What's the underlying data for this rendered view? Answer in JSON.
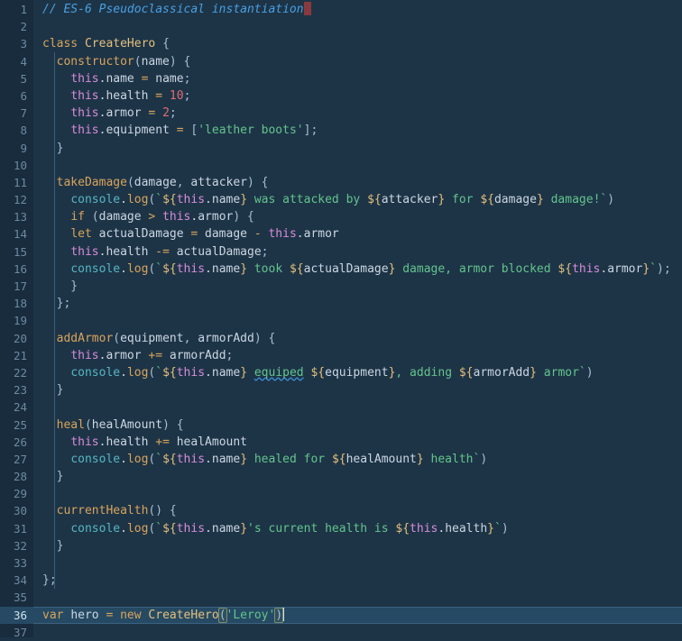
{
  "editor": {
    "name": "code-editor",
    "language": "javascript",
    "total_lines": 37,
    "active_line": 36,
    "colors": {
      "background": "#1d3447",
      "gutter_background": "#182c3e",
      "active_line_background": "#264a63",
      "line_number": "#6e8a9e",
      "default_text": "#cbd6e2",
      "comment": "#4a9fe0",
      "keyword": "#d9a45b",
      "string": "#64c48c",
      "number": "#e06c75",
      "this_keyword": "#d88cd8",
      "console_object": "#56b6c2",
      "template_delim": "#e5c07b",
      "punctuation": "#a8bdd0",
      "spellcheck_underline": "#3d8fd6",
      "cursor_primary": "#8a3a3f",
      "indent_guide": "#3b5e77"
    }
  },
  "gutter": {
    "line_numbers": [
      1,
      2,
      3,
      4,
      5,
      6,
      7,
      8,
      9,
      10,
      11,
      12,
      13,
      14,
      15,
      16,
      17,
      18,
      19,
      20,
      21,
      22,
      23,
      24,
      25,
      26,
      27,
      28,
      29,
      30,
      31,
      32,
      33,
      34,
      35,
      36,
      37
    ]
  },
  "code": {
    "lines": [
      {
        "n": 1,
        "text": "// ES-6 Pseudoclassical instantiation"
      },
      {
        "n": 2,
        "text": ""
      },
      {
        "n": 3,
        "text": "class CreateHero {"
      },
      {
        "n": 4,
        "text": "  constructor(name) {"
      },
      {
        "n": 5,
        "text": "    this.name = name;"
      },
      {
        "n": 6,
        "text": "    this.health = 10;"
      },
      {
        "n": 7,
        "text": "    this.armor = 2;"
      },
      {
        "n": 8,
        "text": "    this.equipment = ['leather boots'];"
      },
      {
        "n": 9,
        "text": "  }"
      },
      {
        "n": 10,
        "text": ""
      },
      {
        "n": 11,
        "text": "  takeDamage(damage, attacker) {"
      },
      {
        "n": 12,
        "text": "    console.log(`${this.name} was attacked by ${attacker} for ${damage} damage!`)"
      },
      {
        "n": 13,
        "text": "    if (damage > this.armor) {"
      },
      {
        "n": 14,
        "text": "    let actualDamage = damage - this.armor"
      },
      {
        "n": 15,
        "text": "    this.health -= actualDamage;"
      },
      {
        "n": 16,
        "text": "    console.log(`${this.name} took ${actualDamage} damage, armor blocked ${this.armor}`);"
      },
      {
        "n": 17,
        "text": "    }"
      },
      {
        "n": 18,
        "text": "  };"
      },
      {
        "n": 19,
        "text": ""
      },
      {
        "n": 20,
        "text": "  addArmor(equipment, armorAdd) {"
      },
      {
        "n": 21,
        "text": "    this.armor += armorAdd;"
      },
      {
        "n": 22,
        "text": "    console.log(`${this.name} equiped ${equipment}, adding ${armorAdd} armor`)"
      },
      {
        "n": 23,
        "text": "  }"
      },
      {
        "n": 24,
        "text": ""
      },
      {
        "n": 25,
        "text": "  heal(healAmount) {"
      },
      {
        "n": 26,
        "text": "    this.health += healAmount"
      },
      {
        "n": 27,
        "text": "    console.log(`${this.name} healed for ${healAmount} health`)"
      },
      {
        "n": 28,
        "text": "  }"
      },
      {
        "n": 29,
        "text": ""
      },
      {
        "n": 30,
        "text": "  currentHealth() {"
      },
      {
        "n": 31,
        "text": "    console.log(`${this.name}'s current health is ${this.health}`)"
      },
      {
        "n": 32,
        "text": "  }"
      },
      {
        "n": 33,
        "text": ""
      },
      {
        "n": 34,
        "text": "};"
      },
      {
        "n": 35,
        "text": ""
      },
      {
        "n": 36,
        "text": "var hero = new CreateHero('Leroy')"
      },
      {
        "n": 37,
        "text": ""
      }
    ],
    "tokens": {
      "comment_line1": "// ES-6 Pseudoclassical instantiation",
      "kw_class": "class",
      "name_CreateHero": "CreateHero",
      "kw_constructor": "constructor",
      "kw_this": "this",
      "kw_let": "let",
      "kw_if": "if",
      "kw_var": "var",
      "kw_new": "new",
      "obj_console": "console",
      "method_log": "log",
      "method_takeDamage": "takeDamage",
      "method_addArmor": "addArmor",
      "method_heal": "heal",
      "method_currentHealth": "currentHealth",
      "var_hero": "hero",
      "str_leather_boots": "'leather boots'",
      "str_leroy": "'Leroy'",
      "num_10": "10",
      "num_2": "2",
      "misspelled_word": "equiped",
      "prop_name": "name",
      "prop_health": "health",
      "prop_armor": "armor",
      "prop_equipment": "equipment",
      "param_damage": "damage",
      "param_attacker": "attacker",
      "param_armorAdd": "armorAdd",
      "param_healAmount": "healAmount",
      "local_actualDamage": "actualDamage"
    }
  }
}
